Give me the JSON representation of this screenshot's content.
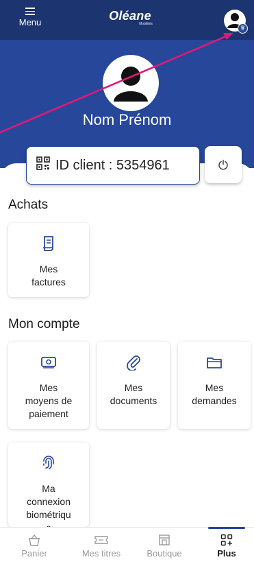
{
  "header": {
    "menu_label": "Menu",
    "logo_main": "Oléane",
    "logo_sub": "Mobilités"
  },
  "profile": {
    "name": "Nom Prénom",
    "client_id": "ID client : 5354961"
  },
  "sections": {
    "achats": {
      "title": "Achats",
      "tiles": [
        {
          "label": "Mes\nfactures",
          "icon": "receipt-icon"
        }
      ]
    },
    "compte": {
      "title": "Mon compte",
      "tiles": [
        {
          "label": "Mes\nmoyens de\npaiement",
          "icon": "payment-icon"
        },
        {
          "label": "Mes\ndocuments",
          "icon": "paperclip-icon"
        },
        {
          "label": "Mes\ndemandes",
          "icon": "folder-icon"
        },
        {
          "label": "Ma\nconnexion\nbiométriqu\ne",
          "icon": "fingerprint-icon"
        }
      ]
    }
  },
  "bottom_nav": [
    {
      "label": "Panier",
      "icon": "basket-icon",
      "active": false
    },
    {
      "label": "Mes titres",
      "icon": "ticket-icon",
      "active": false
    },
    {
      "label": "Boutique",
      "icon": "shop-icon",
      "active": false
    },
    {
      "label": "Plus",
      "icon": "grid-plus-icon",
      "active": true
    }
  ],
  "colors": {
    "header": "#1c3470",
    "band": "#27479a",
    "annotation": "#e0197a"
  }
}
